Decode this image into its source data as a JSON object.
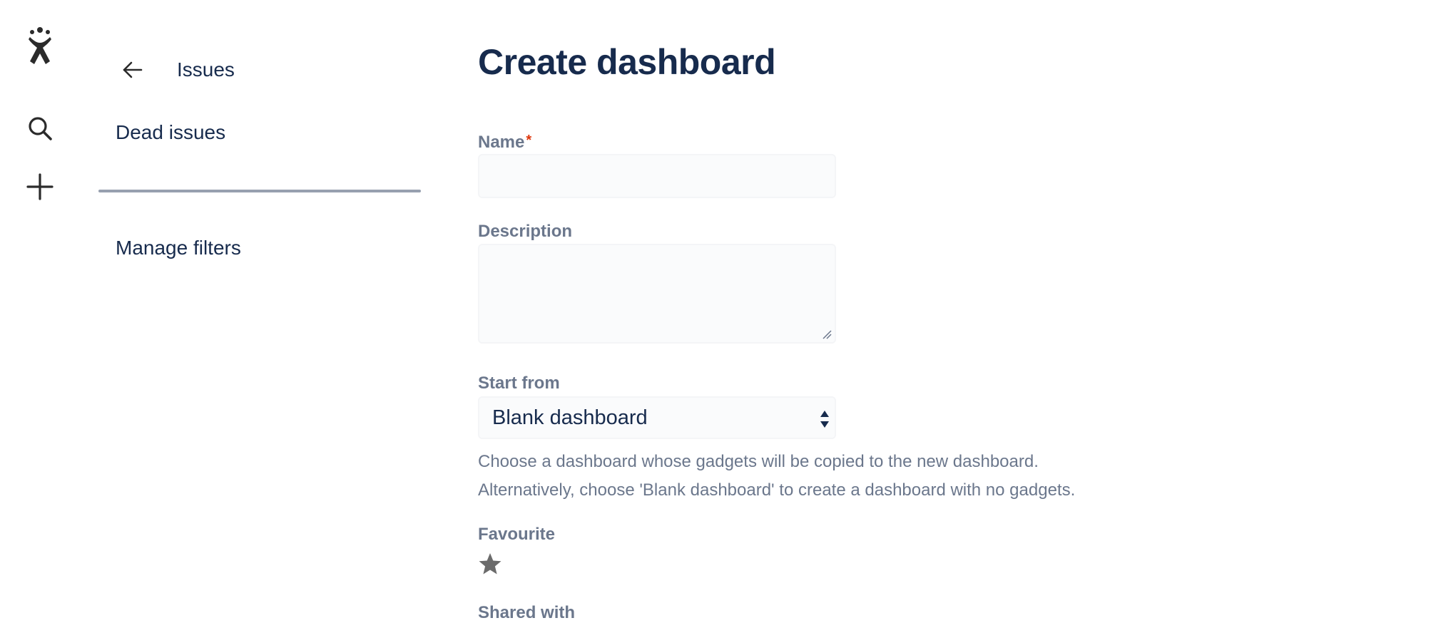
{
  "global_nav": {
    "logo_icon": "jira-logo-icon",
    "search_icon": "search-icon",
    "create_icon": "plus-icon"
  },
  "sidebar": {
    "back_title": "Issues",
    "items": [
      {
        "label": "Dead issues"
      },
      {
        "label": "Manage filters"
      }
    ]
  },
  "form": {
    "title": "Create dashboard",
    "name_label": "Name",
    "name_required_marker": "*",
    "name_value": "",
    "description_label": "Description",
    "description_value": "",
    "start_from_label": "Start from",
    "start_from_value": "Blank dashboard",
    "help_line_1": "Choose a dashboard whose gadgets will be copied to the new dashboard.",
    "help_line_2": "Alternatively, choose 'Blank dashboard' to create a dashboard with no gadgets.",
    "favourite_label": "Favourite",
    "favourite_icon": "star-icon",
    "shared_with_label": "Shared with"
  },
  "colors": {
    "heading": "#172b4d",
    "label": "#6b778c",
    "required": "#de350b",
    "divider": "#97a0af",
    "field_bg": "#fafbfc"
  }
}
